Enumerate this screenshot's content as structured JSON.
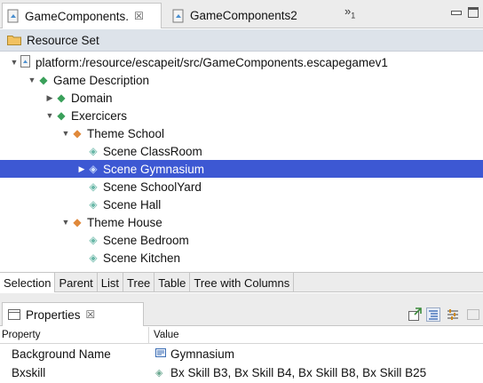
{
  "editor_tabs": [
    {
      "label": "GameComponents.",
      "close": "☒"
    },
    {
      "label": "GameComponents2"
    }
  ],
  "overflow": {
    "chevron": "»",
    "count": "1"
  },
  "resource_set": {
    "label": "Resource Set"
  },
  "tree": {
    "nodes": [
      {
        "label": "platform:/resource/escapeit/src/GameComponents.escapegamev1",
        "icon": "resource-file-icon"
      },
      {
        "label": "Game Description",
        "icon": "green-diamond-icon"
      },
      {
        "label": "Domain",
        "icon": "green-diamond-icon"
      },
      {
        "label": "Exercicers",
        "icon": "green-diamond-icon"
      },
      {
        "label": "Theme School",
        "icon": "orange-diamond-icon"
      },
      {
        "label": "Scene ClassRoom",
        "icon": "teal-diamond-icon"
      },
      {
        "label": "Scene Gymnasium",
        "icon": "teal-diamond-icon"
      },
      {
        "label": "Scene SchoolYard",
        "icon": "teal-diamond-icon"
      },
      {
        "label": "Scene Hall",
        "icon": "teal-diamond-icon"
      },
      {
        "label": "Theme House",
        "icon": "orange-diamond-icon"
      },
      {
        "label": "Scene Bedroom",
        "icon": "teal-diamond-icon"
      },
      {
        "label": "Scene Kitchen",
        "icon": "teal-diamond-icon"
      }
    ],
    "selected_index": 6,
    "selection_color": "#3d58d3"
  },
  "page_tabs": [
    "Selection",
    "Parent",
    "List",
    "Tree",
    "Table",
    "Tree with Columns"
  ],
  "properties": {
    "title": "Properties",
    "close": "☒",
    "columns": [
      "Property",
      "Value"
    ],
    "rows": [
      {
        "property": "Background Name",
        "value": "Gymnasium"
      },
      {
        "property": "Bxskill",
        "value": "Bx Skill B3, Bx Skill B4, Bx Skill B8, Bx Skill B25"
      }
    ]
  }
}
